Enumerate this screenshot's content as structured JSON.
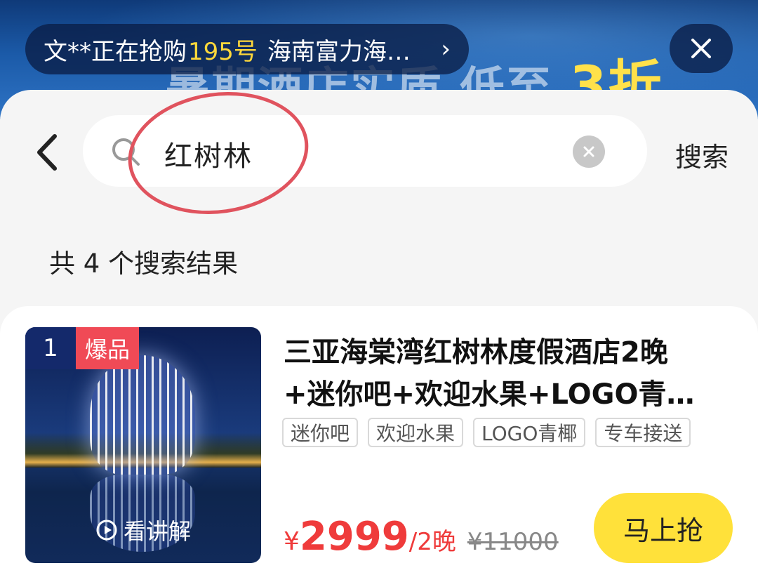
{
  "banner": {
    "promo_text": "暑期酒店实质",
    "promo_text2": "低至",
    "promo_highlight": "3折"
  },
  "ticker": {
    "prefix": "文**正在抢购",
    "number": "195号",
    "product": "海南富力海…",
    "chevron": "›"
  },
  "search": {
    "query": "红树林",
    "submit_label": "搜索"
  },
  "results": {
    "count_label": "共 4 个搜索结果"
  },
  "product": {
    "rank": "1",
    "hot_badge": "爆品",
    "explain_label": "看讲解",
    "title_line1": "三亚海棠湾红树林度假酒店2晚",
    "title_line2": "+迷你吧+欢迎水果+LOGO青…",
    "tags": [
      "迷你吧",
      "欢迎水果",
      "LOGO青椰",
      "专车接送"
    ],
    "price_symbol": "¥",
    "price": "2999",
    "price_unit": "/2晚",
    "original_price": "¥11000",
    "buy_label": "马上抢"
  },
  "colors": {
    "accent_red": "#ef3b3b",
    "buy_yellow": "#ffe13a",
    "annotation": "#e0535e"
  }
}
